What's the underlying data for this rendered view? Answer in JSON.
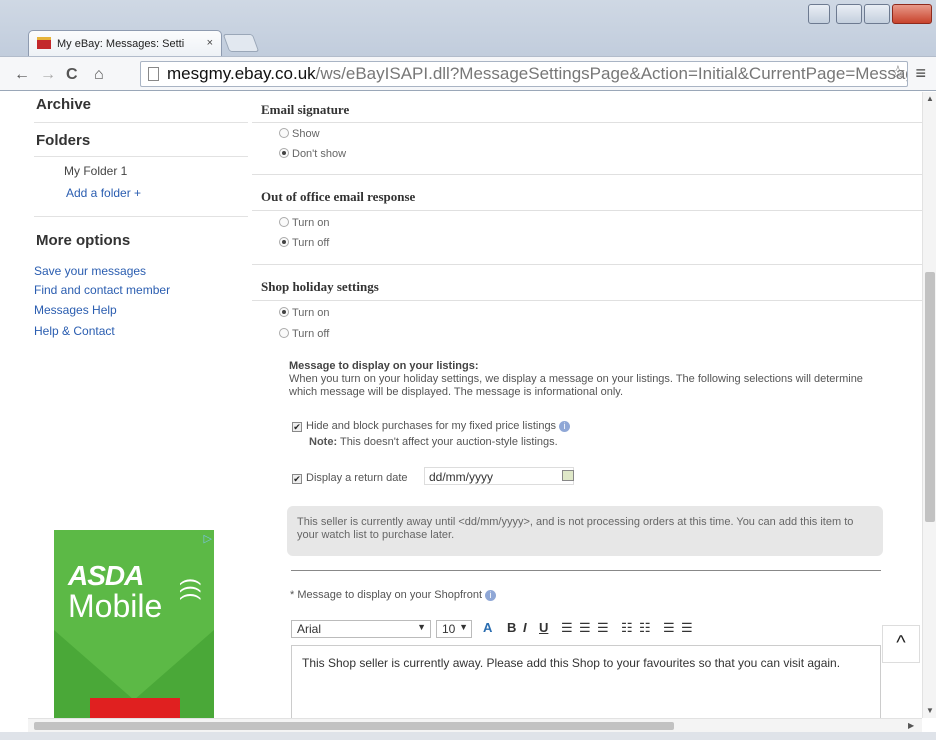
{
  "browser": {
    "tab_title": "My eBay: Messages: Setti",
    "tab_close": "×",
    "url_host": "mesgmy.ebay.co.uk",
    "url_path": "/ws/eBayISAPI.dll?MessageSettingsPage&Action=Initial&CurrentPage=MessageS",
    "back": "←",
    "forward": "→",
    "reload": "C",
    "home": "⌂",
    "star": "☆",
    "menu": "≡"
  },
  "sidebar": {
    "archive": "Archive",
    "folders": "Folders",
    "folder_1": "My Folder 1",
    "add_folder": "Add a folder +",
    "more_options": "More options",
    "links": [
      "Save your messages",
      "Find and contact member",
      "Messages Help",
      "Help & Contact"
    ]
  },
  "ad": {
    "brand_top": "ASDA",
    "brand_bottom": "Mobile",
    "ad_choices": "▷"
  },
  "email_signature": {
    "heading": "Email signature",
    "options": [
      "Show",
      "Don't show"
    ],
    "selected": "Don't show"
  },
  "out_of_office": {
    "heading": "Out of office email response",
    "options": [
      "Turn on",
      "Turn off"
    ],
    "selected": "Turn off"
  },
  "shop_holiday": {
    "heading": "Shop holiday settings",
    "options": [
      "Turn on",
      "Turn off"
    ],
    "selected": "Turn on",
    "message_heading": "Message to display on your listings:",
    "message_desc": "When you turn on your holiday settings, we display a message on your listings. The following selections will determine which message will be displayed. The message is informational only.",
    "hide_block_label": "Hide and block purchases for my fixed price listings",
    "note_label": "Note:",
    "note_text": "This doesn't affect your auction-style listings.",
    "return_date_label": "Display a return date",
    "return_date_value": "dd/mm/yyyy",
    "preview_text": "This seller is currently away until <dd/mm/yyyy>, and is not processing orders at this time. You can add this item to your watch list to purchase later.",
    "shopfront_label": "* Message to display on your Shopfront",
    "font_family": "Arial",
    "font_size": "10",
    "editor_text": "This Shop seller is currently away. Please add this Shop to your favourites so that you can visit again."
  },
  "toolbar_icons": [
    "A",
    "B",
    "I",
    "U"
  ],
  "scroll_top_label": "^"
}
